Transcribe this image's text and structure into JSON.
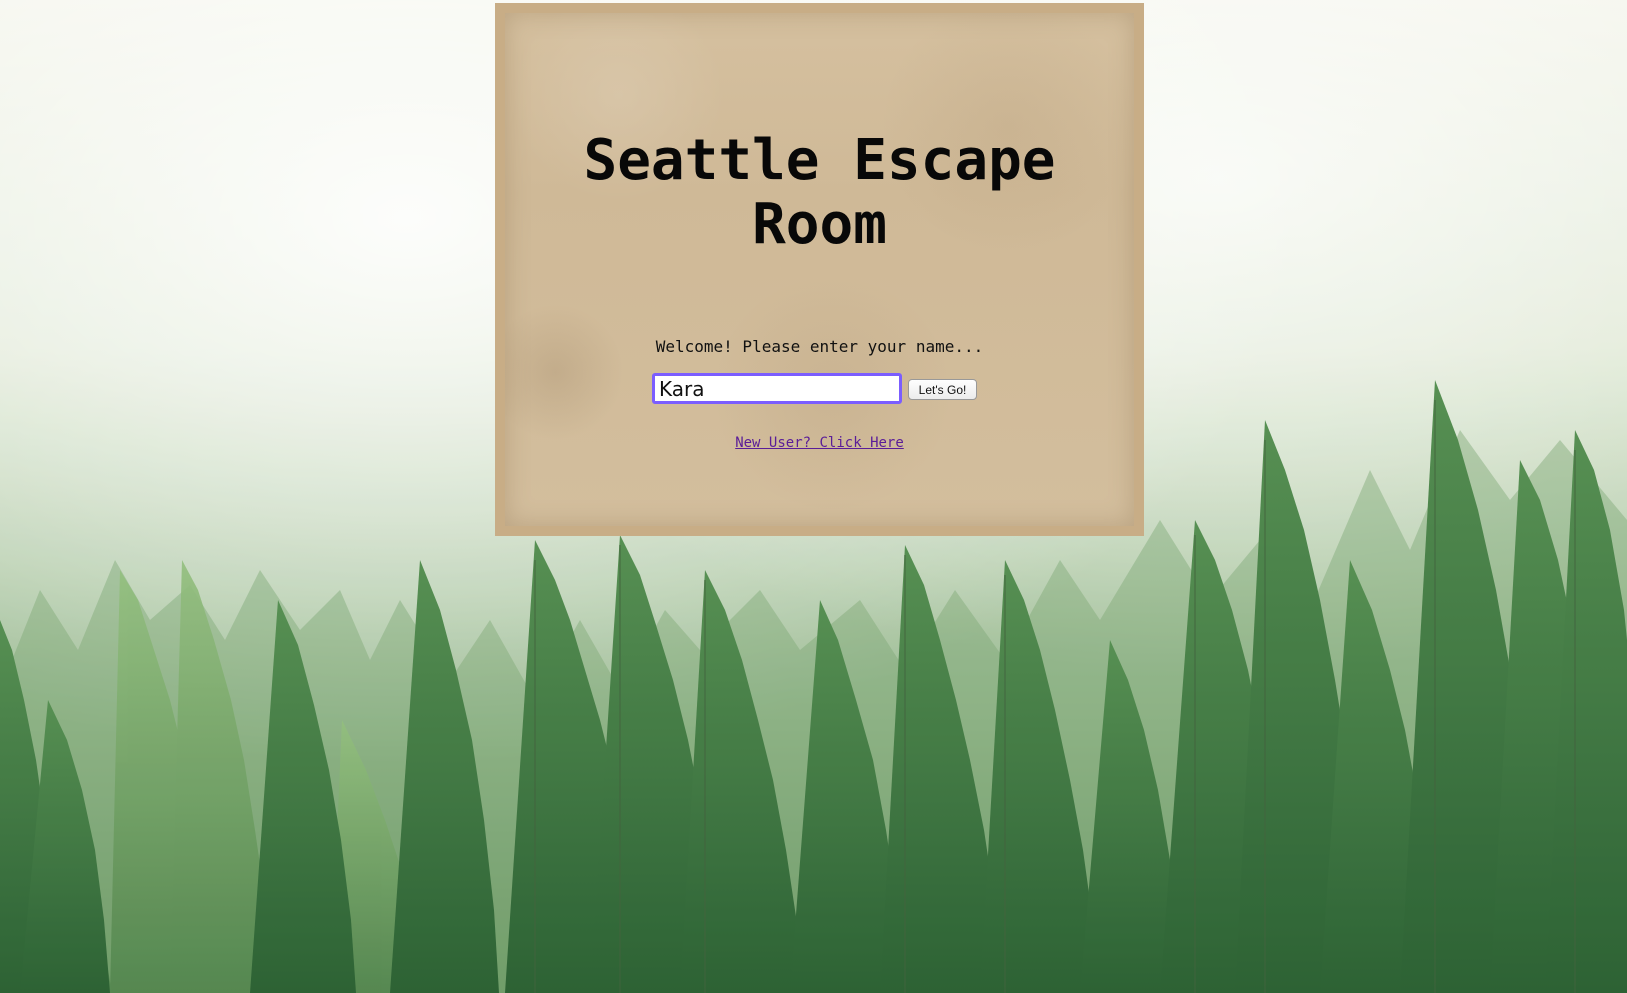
{
  "page": {
    "title": "Seattle Escape Room",
    "welcome_text": "Welcome! Please enter your name...",
    "name_input_value": "Kara",
    "submit_button_label": "Let's Go!",
    "new_user_link": "New User? Click Here"
  },
  "colors": {
    "card_border": "#c8ad86",
    "card_paper": "#d3be9d",
    "input_focus": "#7b5dff",
    "link": "#5a1d98",
    "forest_dark": "#2f6b36",
    "fog": "#eef1e4"
  },
  "background": {
    "description_icon": "foggy-forest-background"
  }
}
